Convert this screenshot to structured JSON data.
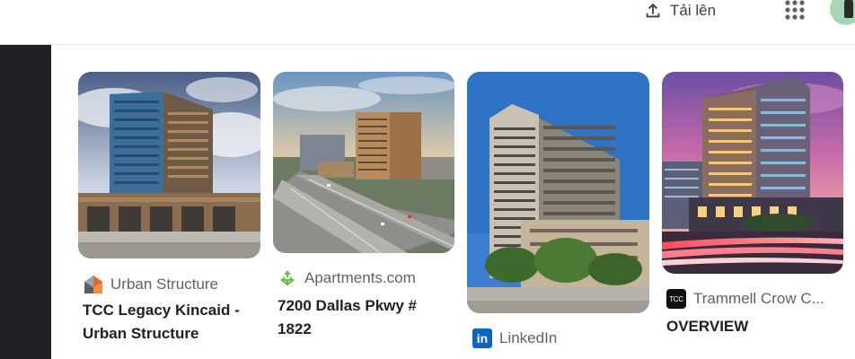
{
  "header": {
    "upload_label": "Tải lên",
    "upload_icon": "upload-icon",
    "apps_icon": "apps-grid-icon",
    "avatar_icon": "account-avatar"
  },
  "results": [
    {
      "source": "Urban Structure",
      "favicon": "urban-structure-logo-icon",
      "title_line1": "TCC Legacy Kincaid -",
      "title_line2": "Urban Structure"
    },
    {
      "source": "Apartments.com",
      "favicon": "apartments-com-logo-icon",
      "title_line1": "7200 Dallas Pkwy #",
      "title_line2": "1822"
    },
    {
      "source": "LinkedIn",
      "favicon": "linkedin-logo-icon",
      "favicon_text": "in"
    },
    {
      "source": "Trammell Crow C...",
      "favicon": "trammell-crow-logo-icon",
      "favicon_text": "TCC",
      "title_line1": "OVERVIEW"
    }
  ],
  "colors": {
    "side_panel": "#202124",
    "source_text": "#5f6368",
    "title_text": "#202124",
    "linkedin_blue": "#0a66c2"
  }
}
